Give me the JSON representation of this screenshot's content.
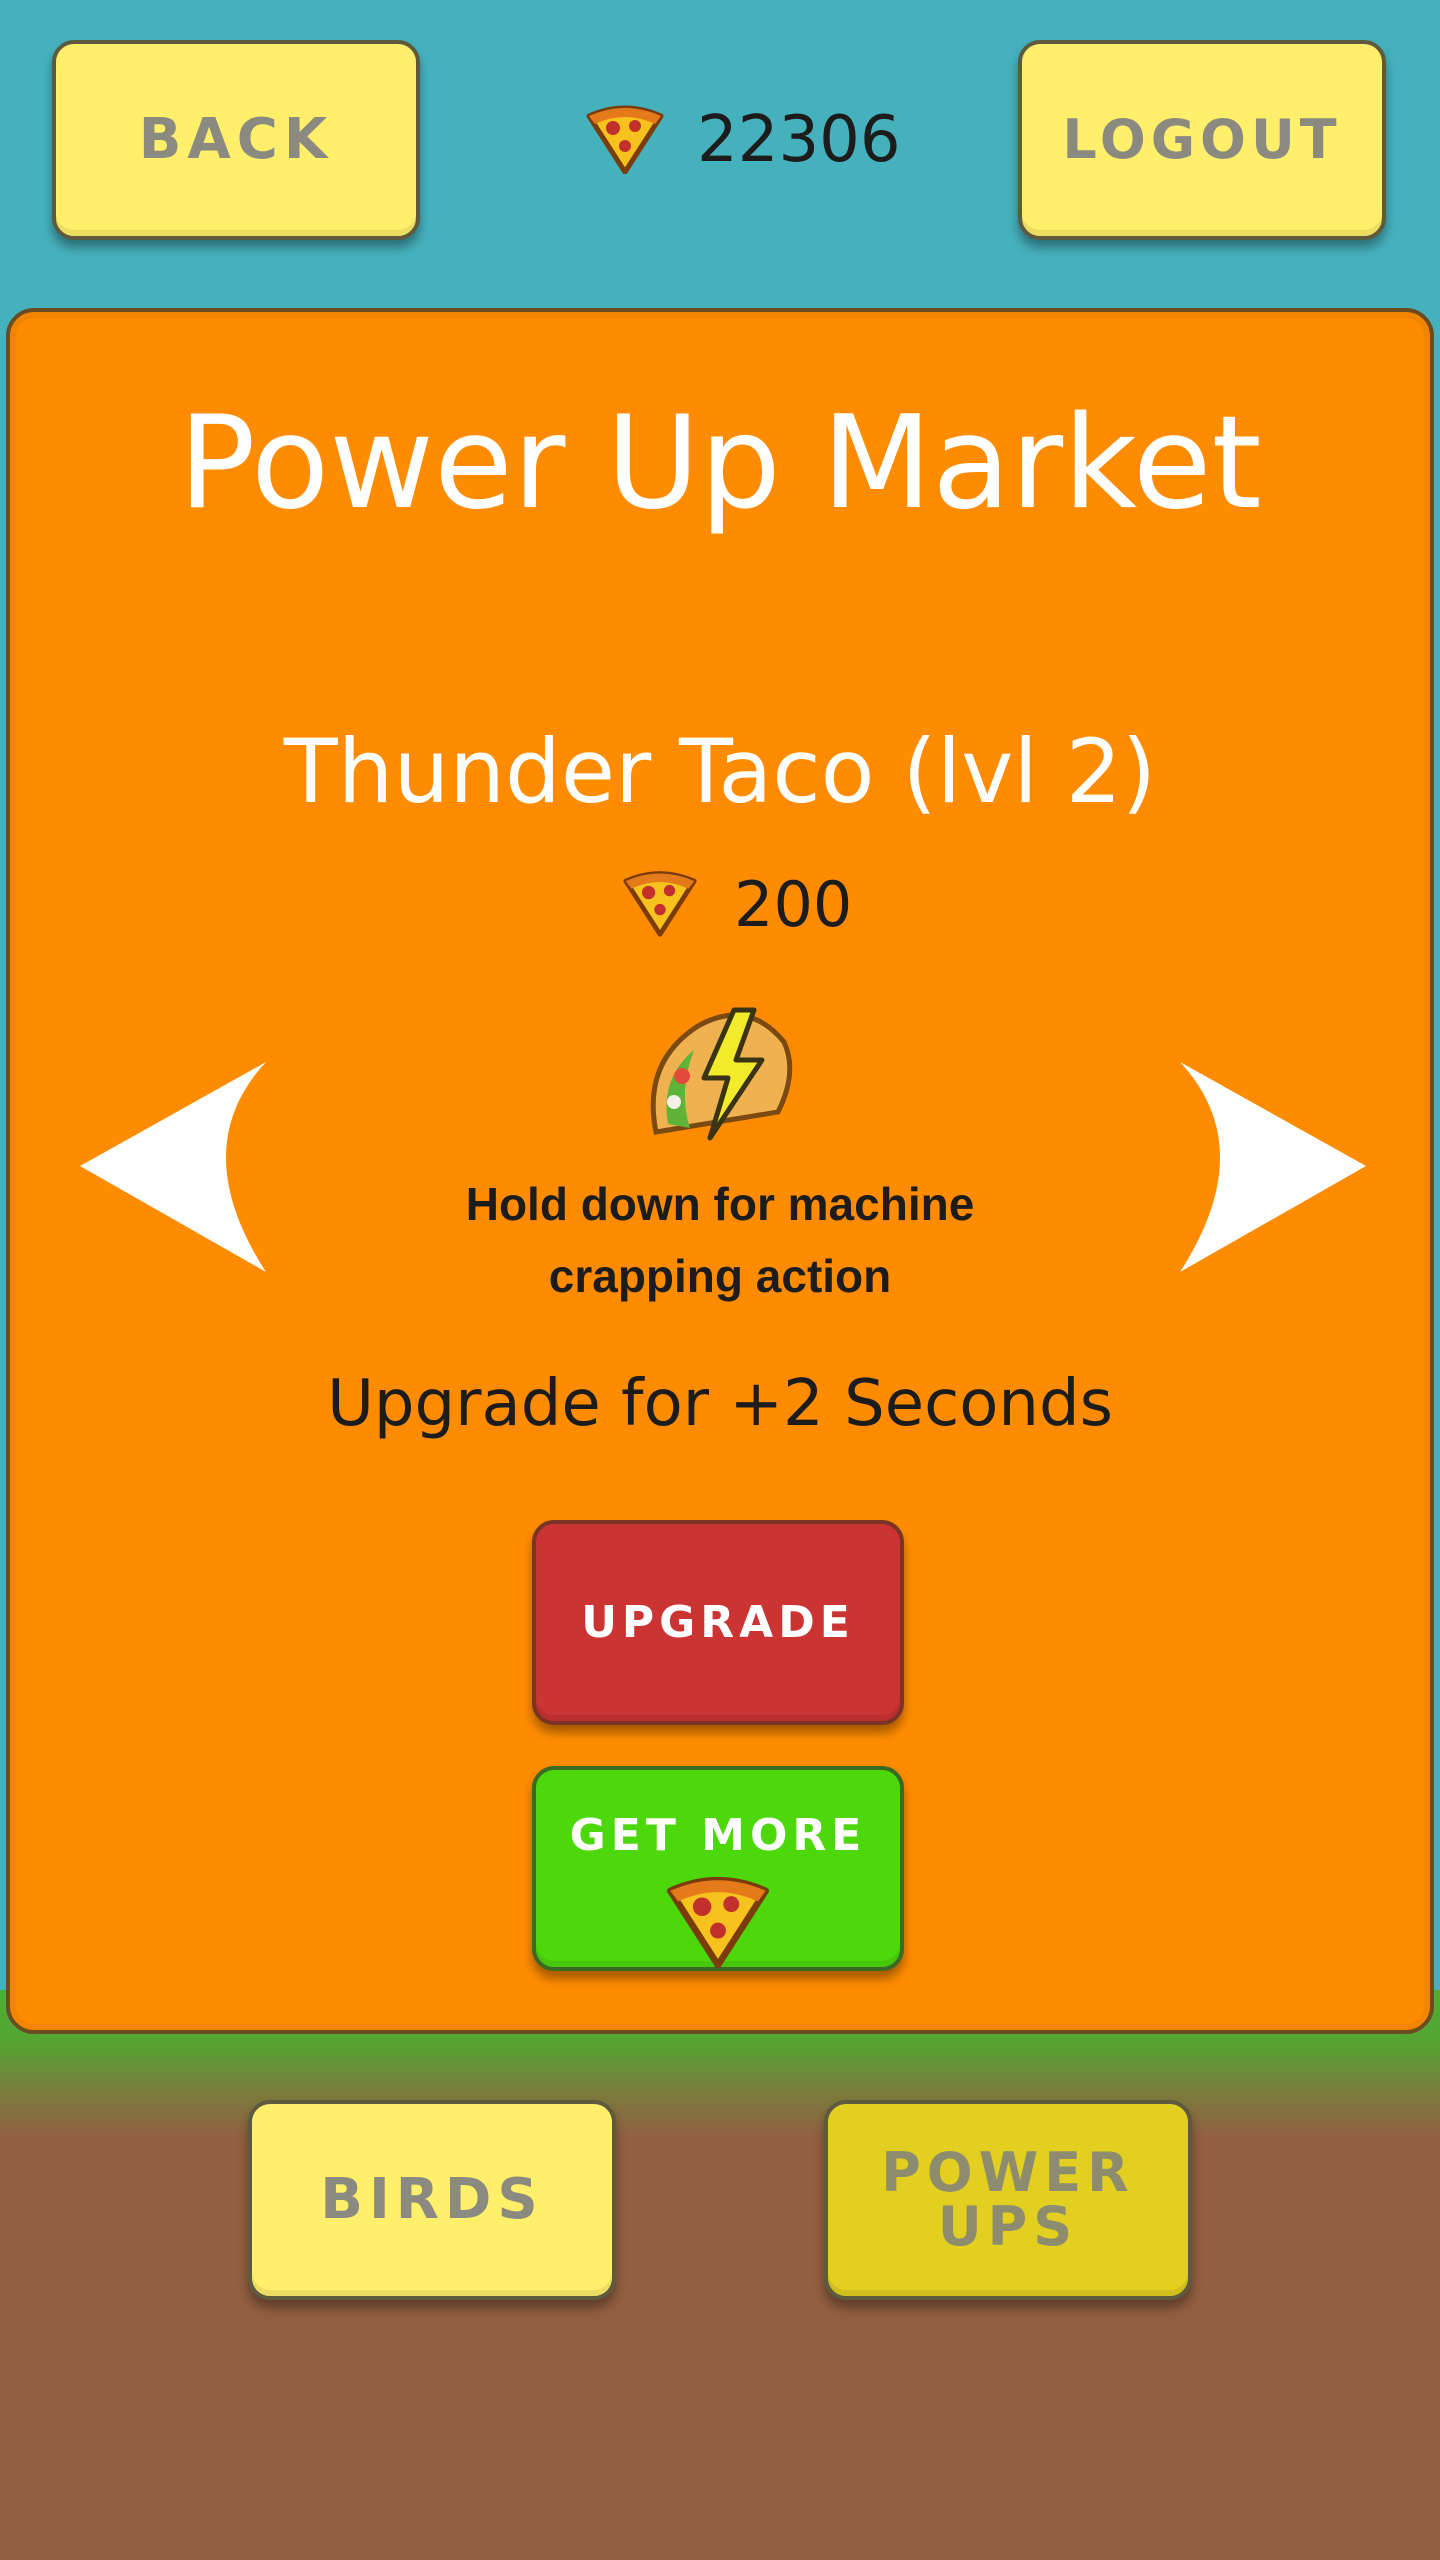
{
  "header": {
    "back_label": "BACK",
    "logout_label": "LOGOUT",
    "balance": "22306",
    "currency_icon": "pizza-slice-icon"
  },
  "market": {
    "title": "Power Up Market",
    "item_name": "Thunder Taco (lvl 2)",
    "price": "200",
    "item_icon": "thunder-taco-icon",
    "description": "Hold down for machine crapping action",
    "upgrade_info": "Upgrade for +2 Seconds",
    "upgrade_label": "UPGRADE",
    "get_more_label": "GET MORE"
  },
  "nav": {
    "birds_label": "BIRDS",
    "powerups_label_line1": "POWER",
    "powerups_label_line2": "UPS"
  },
  "colors": {
    "sky": "#45b1bd",
    "panel": "#ff8c00",
    "button_yellow": "#ffef6b",
    "button_active": "#e2cf1f",
    "upgrade_red": "#cc3333",
    "get_more_green": "#4cd80b",
    "ground": "#925f40"
  }
}
